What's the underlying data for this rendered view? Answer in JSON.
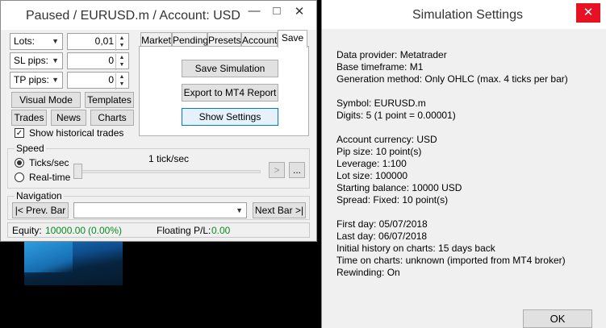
{
  "main_window": {
    "title": "Paused / EURUSD.m / Account: USD",
    "minimize": "—",
    "maximize": "□",
    "close": "✕",
    "lots": {
      "label": "Lots:",
      "value": "0,01"
    },
    "sl": {
      "label": "SL pips:",
      "value": "0"
    },
    "tp": {
      "label": "TP pips:",
      "value": "0"
    },
    "buttons": {
      "visual_mode": "Visual Mode",
      "templates": "Templates",
      "trades": "Trades",
      "news": "News",
      "charts": "Charts"
    },
    "show_historical": {
      "label": "Show historical trades",
      "checked": true
    },
    "tabs": [
      "Market",
      "Pending",
      "Presets",
      "Account",
      "Save"
    ],
    "active_tab": "Save",
    "save_tab": {
      "save_simulation": "Save Simulation",
      "export": "Export to MT4 Report",
      "show_settings": "Show Settings"
    },
    "speed": {
      "group_label": "Speed",
      "ticks_label": "Ticks/sec",
      "realtime_label": "Real-time",
      "rate": "1 tick/sec",
      "play": ">",
      "more": "..."
    },
    "navigation": {
      "group_label": "Navigation",
      "prev": "|< Prev. Bar",
      "next": "Next Bar >|",
      "select_value": ""
    },
    "status": {
      "equity_label": "Equity:",
      "equity_value": "10000.00",
      "equity_pct": "(0.00%)",
      "pl_label": "Floating P/L:",
      "pl_value": "0.00"
    }
  },
  "settings_window": {
    "title": "Simulation Settings",
    "close": "✕",
    "lines": [
      "Data provider: Metatrader",
      "Base timeframe: M1",
      "Generation method: Only OHLC (max. 4 ticks per bar)",
      "",
      "Symbol: EURUSD.m",
      "Digits: 5  (1 point = 0.00001)",
      "",
      "Account currency: USD",
      "Pip size: 10 point(s)",
      "Leverage: 1:100",
      "Lot size: 100000",
      "Starting balance: 10000 USD",
      "Spread: Fixed: 10 point(s)",
      "",
      "First day: 05/07/2018",
      "Last day: 06/07/2018",
      "Initial history on charts: 15 days back",
      "Time on charts: unknown (imported from MT4 broker)",
      "Rewinding: On"
    ],
    "ok": "OK"
  },
  "colors": {
    "status_green": "#0a8a1e",
    "close_red": "#e81123"
  }
}
